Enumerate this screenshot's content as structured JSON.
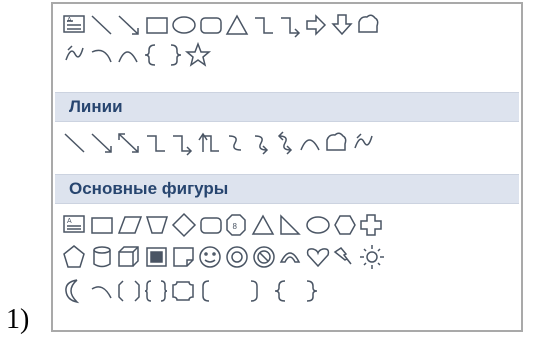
{
  "item_number": "1)",
  "sections": {
    "lines": {
      "title": "Линии"
    },
    "basic_shapes": {
      "title": "Основные фигуры"
    }
  },
  "colors": {
    "stroke": "#4a5564",
    "section_bg": "#dde3ee",
    "section_text": "#27456f",
    "panel_border": "#a9a9a9"
  },
  "recent_shapes_row1": [
    "text-box",
    "line",
    "arrow",
    "rectangle",
    "oval",
    "rounded-rectangle",
    "triangle",
    "elbow-connector",
    "elbow-arrow-connector",
    "right-arrow",
    "down-arrow",
    "flowchart-alternate"
  ],
  "recent_shapes_row2": [
    "freeform",
    "curve",
    "arc",
    "left-brace",
    "right-brace",
    "star"
  ],
  "line_shapes": [
    "line",
    "arrow",
    "double-arrow",
    "elbow-connector",
    "elbow-arrow-connector",
    "elbow-double-arrow",
    "curved-connector",
    "curved-arrow-connector",
    "curved-double-arrow",
    "curve",
    "freeform",
    "scribble"
  ],
  "basic_shapes_row1": [
    "text-box",
    "rectangle",
    "parallelogram",
    "trapezoid",
    "diamond",
    "rounded-rectangle",
    "octagon",
    "triangle",
    "right-triangle",
    "oval",
    "hexagon",
    "cross"
  ],
  "basic_shapes_row2": [
    "pentagon",
    "can",
    "cube",
    "bevel",
    "folded-corner",
    "smiley-face",
    "donut",
    "no-symbol",
    "block-arc",
    "heart",
    "lightning-bolt",
    "sun"
  ],
  "basic_shapes_row3": [
    "moon",
    "arc",
    "double-bracket",
    "double-brace",
    "plaque",
    "left-bracket",
    "right-bracket",
    "left-brace",
    "right-brace"
  ]
}
